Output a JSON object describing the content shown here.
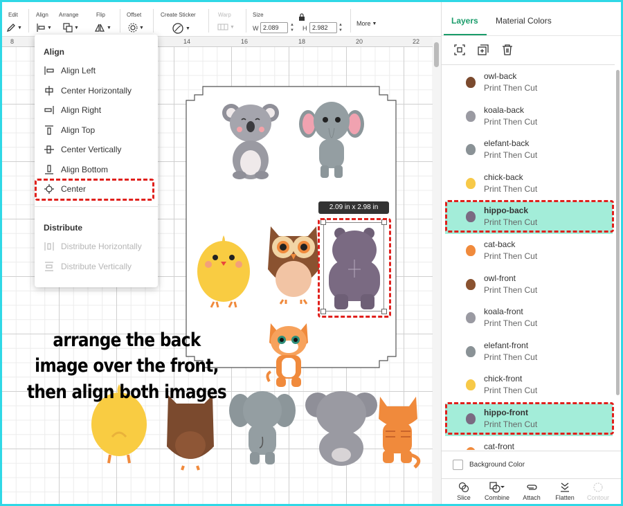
{
  "toolbar": {
    "edit": "Edit",
    "align": "Align",
    "arrange": "Arrange",
    "flip": "Flip",
    "offset": "Offset",
    "create_sticker": "Create Sticker",
    "warp": "Warp",
    "size": "Size",
    "w_label": "W",
    "w_value": "2.089",
    "h_label": "H",
    "h_value": "2.982",
    "more": "More"
  },
  "ruler": [
    "8",
    "14",
    "16",
    "18",
    "20",
    "22"
  ],
  "align_menu": {
    "align_header": "Align",
    "items": [
      "Align Left",
      "Center Horizontally",
      "Align Right",
      "Align Top",
      "Center Vertically",
      "Align Bottom",
      "Center"
    ],
    "distribute_header": "Distribute",
    "distribute_items": [
      "Distribute Horizontally",
      "Distribute Vertically"
    ]
  },
  "instruction": "arrange the back image over the front, then align both images",
  "selection": {
    "dimensions": "2.09  in x 2.98  in"
  },
  "panel": {
    "tabs": [
      "Layers",
      "Material Colors"
    ],
    "layers": [
      {
        "name": "owl-back",
        "op": "Print Then Cut",
        "color": "#7b4a2e"
      },
      {
        "name": "koala-back",
        "op": "Print Then Cut",
        "color": "#9a9aa2"
      },
      {
        "name": "elefant-back",
        "op": "Print Then Cut",
        "color": "#8a9296"
      },
      {
        "name": "chick-back",
        "op": "Print Then Cut",
        "color": "#f7c948"
      },
      {
        "name": "hippo-back",
        "op": "Print Then Cut",
        "color": "#7a6a82"
      },
      {
        "name": "cat-back",
        "op": "Print Then Cut",
        "color": "#f08a3c"
      },
      {
        "name": "owl-front",
        "op": "Print Then Cut",
        "color": "#8a5230"
      },
      {
        "name": "koala-front",
        "op": "Print Then Cut",
        "color": "#9a9aa2"
      },
      {
        "name": "elefant-front",
        "op": "Print Then Cut",
        "color": "#8a9296"
      },
      {
        "name": "chick-front",
        "op": "Print Then Cut",
        "color": "#f7c948"
      },
      {
        "name": "hippo-front",
        "op": "Print Then Cut",
        "color": "#7a6a82"
      },
      {
        "name": "cat-front",
        "op": "",
        "color": "#f08a3c"
      }
    ],
    "background_color": "Background Color",
    "bottom": [
      "Slice",
      "Combine",
      "Attach",
      "Flatten",
      "Contour"
    ]
  },
  "colors": {
    "accent": "#1a9c6a",
    "highlight": "#e0201c",
    "selected_row": "#a3edd9",
    "frame": "#2fd8e6"
  }
}
